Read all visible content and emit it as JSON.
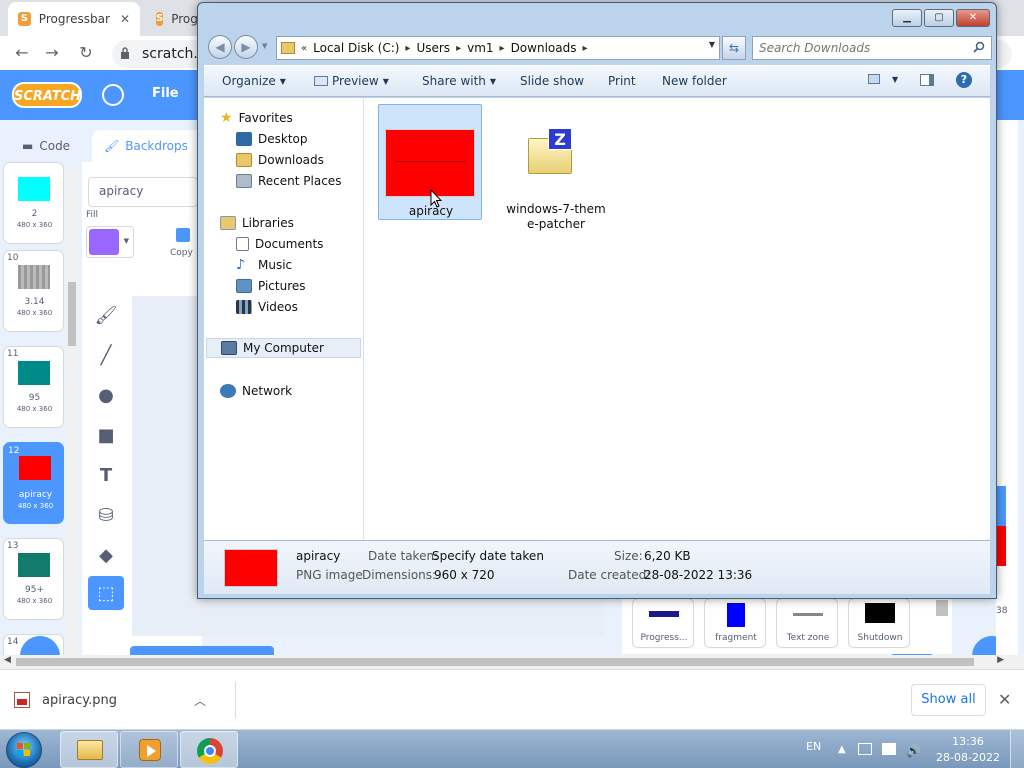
{
  "browser": {
    "tabs": [
      {
        "title": "Progressbar",
        "favicon": "S"
      },
      {
        "title": "Prog",
        "favicon": "S"
      }
    ],
    "url": "scratch.m"
  },
  "scratch": {
    "logo_text": "SCRATCH",
    "menu_file": "File",
    "tabs": {
      "code": "Code",
      "backdrops": "Backdrops"
    },
    "costume_name_value": "apiracy",
    "fill_label": "Fill",
    "fill_color": "#9966ff",
    "copy_label": "Copy",
    "costumes": [
      {
        "num": "",
        "name": "2",
        "dims": "480 x 360",
        "color": "#00ffff"
      },
      {
        "num": "10",
        "name": "3.14",
        "dims": "480 x 360",
        "color": "#888888"
      },
      {
        "num": "11",
        "name": "95",
        "dims": "480 x 360",
        "color": "#008b8b"
      },
      {
        "num": "12",
        "name": "apiracy",
        "dims": "480 x 360",
        "color": "#ff0000"
      },
      {
        "num": "13",
        "name": "95+",
        "dims": "480 x 360",
        "color": "#127b6e"
      },
      {
        "num": "14",
        "name": "",
        "dims": "",
        "color": "#ffffff"
      }
    ],
    "sprite_tiles": [
      {
        "label": "Progress...",
        "color": "#1a1a8c"
      },
      {
        "label": "fragment",
        "color": "#0000ff"
      },
      {
        "label": "Text zone",
        "color": "#888888"
      },
      {
        "label": "Shutdown",
        "color": "#000000"
      }
    ],
    "right_number": "38"
  },
  "explorer": {
    "breadcrumb": [
      "Local Disk (C:)",
      "Users",
      "vm1",
      "Downloads"
    ],
    "search_placeholder": "Search Downloads",
    "commands": {
      "organize": "Organize",
      "preview": "Preview",
      "share_with": "Share with",
      "slide_show": "Slide show",
      "print": "Print",
      "new_folder": "New folder"
    },
    "nav": {
      "favorites": "Favorites",
      "desktop": "Desktop",
      "downloads": "Downloads",
      "recent_places": "Recent Places",
      "libraries": "Libraries",
      "documents": "Documents",
      "music": "Music",
      "pictures": "Pictures",
      "videos": "Videos",
      "my_computer": "My Computer",
      "network": "Network"
    },
    "files": [
      {
        "name": "apiracy",
        "type": "image"
      },
      {
        "name_line1": "windows-7-them",
        "name_line2": "e-patcher",
        "type": "archive"
      }
    ],
    "details": {
      "name": "apiracy",
      "type": "PNG image",
      "date_taken_label": "Date taken:",
      "date_taken_value": "Specify date taken",
      "dimensions_label": "Dimensions:",
      "dimensions_value": "960 x 720",
      "size_label": "Size:",
      "size_value": "6,20 KB",
      "date_created_label": "Date created:",
      "date_created_value": "28-08-2022 13:36"
    }
  },
  "download_shelf": {
    "file": "apiracy.png",
    "show_all": "Show all"
  },
  "taskbar": {
    "language": "EN",
    "time": "13:36",
    "date": "28-08-2022"
  }
}
